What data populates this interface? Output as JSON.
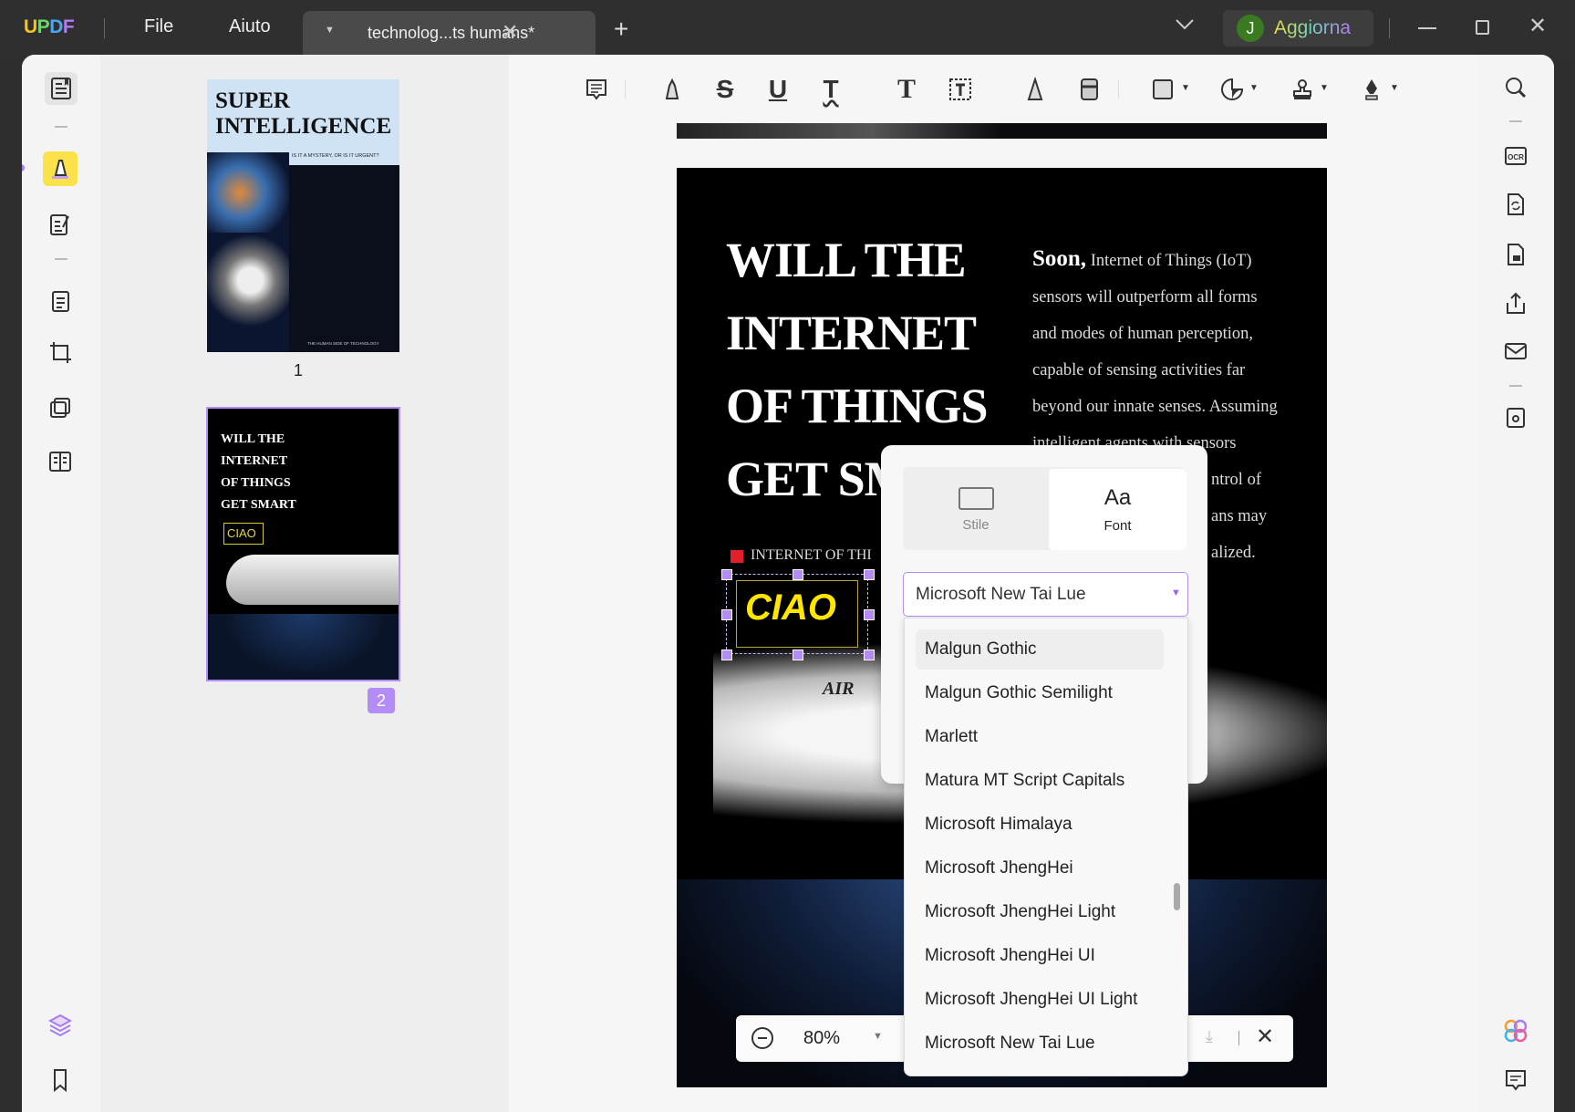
{
  "app": {
    "logo": "UPDF",
    "menu": [
      "File",
      "Aiuto"
    ],
    "tab_title": "technolog...ts humans*",
    "user_initial": "J",
    "upgrade_label": "Aggiorna"
  },
  "toolbar": {
    "icons": [
      "comment-icon",
      "highlight-icon",
      "strikethrough-icon",
      "underline-icon",
      "squiggly-underline-icon",
      "text-icon",
      "textbox-icon",
      "pencil-icon",
      "eraser-icon",
      "shape-icon",
      "sticker-icon",
      "stamp-icon",
      "signature-icon"
    ]
  },
  "thumbnails": [
    {
      "label": "1",
      "title": "SUPER INTELLIGENCE",
      "subtitle": "IS IT A MYSTERY, OR IS IT URGENT?",
      "footer": "THE HUMAN SIDE OF TECHNOLOGY"
    },
    {
      "label": "2",
      "selected": true
    }
  ],
  "page": {
    "headline": [
      "WILL THE",
      "INTERNET",
      "OF THINGS",
      "GET SM"
    ],
    "lead_word": "Soon,",
    "body_lines": [
      "Internet of Things (IoT)",
      "sensors will outperform all forms",
      "and modes of  human perception,",
      "capable of sensing activities far",
      "beyond our innate senses. Assuming",
      "intelligent agents with sensors"
    ],
    "body_fragments": [
      "ntrol of",
      "ans may",
      "alized."
    ],
    "tag": "INTERNET OF THI",
    "annotation_text": "CIAO",
    "plane_text": "AIR"
  },
  "popup": {
    "tabs": [
      {
        "label": "Stile",
        "icon": "rectangle-icon",
        "active": false
      },
      {
        "label": "Font",
        "icon_text": "Aa",
        "active": true
      }
    ],
    "selected_font": "Microsoft New Tai Lue",
    "font_options": [
      "Malgun Gothic",
      "Malgun Gothic Semilight",
      "Marlett",
      "Matura MT Script Capitals",
      "Microsoft Himalaya",
      "Microsoft JhengHei",
      "Microsoft JhengHei Light",
      "Microsoft JhengHei UI",
      "Microsoft JhengHei UI Light",
      "Microsoft New Tai Lue"
    ],
    "hovered_option": "Malgun Gothic"
  },
  "zoom": {
    "value": "80%"
  },
  "colors": {
    "accent": "#a77bf3",
    "annotation": "#ffe600",
    "titlebar": "#2f2f2f"
  }
}
